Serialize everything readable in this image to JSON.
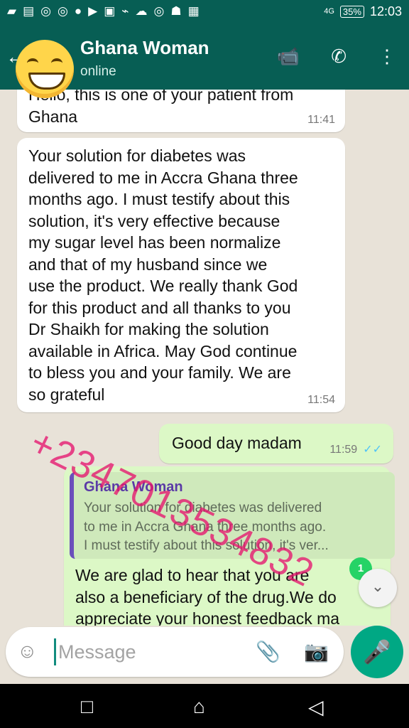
{
  "status": {
    "icons": [
      "app-icon",
      "chat-icon",
      "instagram-icon",
      "instagram-icon",
      "more-icon",
      "play-icon",
      "image-icon",
      "notify-icon",
      "cloud-icon",
      "instagram-icon",
      "profile-icon",
      "card-icon"
    ],
    "network": "4G",
    "battery": "35%",
    "time": "12:03"
  },
  "header": {
    "title": "Ghana Woman",
    "subtitle": "online"
  },
  "messages": [
    {
      "text": "Hello, this is one of your patient from\nGhana",
      "time": "11:41"
    },
    {
      "text": "Your solution for diabetes  was\ndelivered to me in Accra Ghana three\nmonths ago. I must testify about this\nsolution, it's very effective because\nmy sugar level has been normalize\nand that of my husband since we\nuse  the product. We really thank God\nfor this product and all thanks to you\nDr Shaikh for making the solution\navailable in Africa. May God continue\nto bless you and your family. We are\nso grateful",
      "time": "11:54"
    }
  ],
  "outgoing": {
    "text": "Good day madam",
    "time": "11:59"
  },
  "reply": {
    "quote_name": "Ghana Woman",
    "quote_text": "Your solution for diabetes  was delivered\nto me in Accra Ghana three months ago.\nI must testify about this solution, it's ver...",
    "text": "We are glad to hear that you are\nalso a beneficiary of the drug.We do\nappreciate your honest feedback ma"
  },
  "badge": "1",
  "watermark": "+2347013534832",
  "composer": {
    "placeholder": "Message"
  },
  "colors": {
    "header": "#075e54",
    "outgoing_bubble": "#dcf8c6",
    "quote_bar": "#6b4fbb",
    "mic_button": "#00a884"
  }
}
